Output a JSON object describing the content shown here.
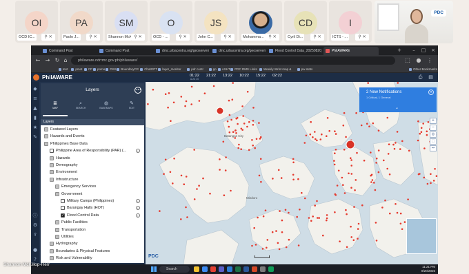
{
  "participants": [
    {
      "initials": "OI",
      "name": "OCD IC...",
      "color": "#f4d5c8"
    },
    {
      "initials": "PA",
      "name": "Paolo J...",
      "color": "#f1d9c9"
    },
    {
      "initials": "SM",
      "name": "Shannon McKi...",
      "color": "#d9dff3"
    },
    {
      "initials": "O",
      "name": "OCD - ...",
      "color": "#d9e2f2"
    },
    {
      "initials": "JS",
      "name": "John C...",
      "color": "#f4e3c1"
    },
    {
      "initials": "",
      "name": "Mohamma...",
      "color": "#eeeeee"
    },
    {
      "initials": "CD",
      "name": "Cyril Di...",
      "color": "#e7e2b7"
    },
    {
      "initials": "I",
      "name": "ICTS - ...",
      "color": "#f3d0d4"
    }
  ],
  "camera": {
    "logo": "PDC"
  },
  "presenter_caption": "Shannon McKillop-Herr",
  "browser": {
    "tabs": [
      {
        "label": "Command Post",
        "active": false
      },
      {
        "label": "Command Post",
        "active": false
      },
      {
        "label": "dmc.urbacentra.org/geoserver/geo...",
        "active": false
      },
      {
        "label": "dmc.urbacentra.org/geoserver/geo...",
        "active": false
      },
      {
        "label": "Flood Control Data_20250820_v4.pdf",
        "active": false
      },
      {
        "label": "PhilAWARE",
        "active": true
      }
    ],
    "url": "philaware.ndrrmc.gov.ph/philaware/",
    "bookmarks": [
      "test",
      "pmot",
      "CP",
      "pomo",
      "DSS",
      "BoundaryCR",
      "ChatGPT",
      "layer_monitor",
      "pdr contr",
      "pp",
      "ASHT",
      "PDC RMS Links",
      "Weekly Wrist map &",
      "pw stats",
      "Other Bookmarks"
    ]
  },
  "app": {
    "title": "PhilAWARE",
    "times": [
      {
        "time": "01:22",
        "date": "AUG 20"
      },
      {
        "time": "21:22",
        "date": ""
      },
      {
        "time": "13:22",
        "date": ""
      },
      {
        "time": "10:22",
        "date": ""
      },
      {
        "time": "15:22",
        "date": ""
      },
      {
        "time": "02:22",
        "date": ""
      }
    ],
    "panel": {
      "title": "Layers",
      "tabs": [
        {
          "label": "MAP",
          "icon": "layers-icon"
        },
        {
          "label": "SEARCH",
          "icon": "search-icon"
        },
        {
          "label": "BASEMAPS",
          "icon": "globe-icon"
        },
        {
          "label": "EDIT",
          "icon": "pencil-icon"
        }
      ],
      "section_label": "Layers"
    },
    "tree": [
      {
        "label": "Featured Layers",
        "indent": 0,
        "kind": "exp",
        "info": false
      },
      {
        "label": "Hazards and Events",
        "indent": 0,
        "kind": "exp",
        "info": false
      },
      {
        "label": "Philippines Base Data",
        "indent": 0,
        "kind": "exp",
        "info": false
      },
      {
        "label": "Philippine Area of Responsibility (PAR) (...",
        "indent": 1,
        "kind": "cb",
        "info": true
      },
      {
        "label": "Hazards",
        "indent": 1,
        "kind": "exp",
        "info": false
      },
      {
        "label": "Demography",
        "indent": 1,
        "kind": "exp",
        "info": false
      },
      {
        "label": "Environment",
        "indent": 1,
        "kind": "exp",
        "info": false
      },
      {
        "label": "Infrastructure",
        "indent": 1,
        "kind": "exp",
        "info": false
      },
      {
        "label": "Emergency Services",
        "indent": 2,
        "kind": "exp",
        "info": false
      },
      {
        "label": "Government",
        "indent": 2,
        "kind": "exp",
        "info": false
      },
      {
        "label": "Military Camps (Philippines)",
        "indent": 3,
        "kind": "cb",
        "info": true
      },
      {
        "label": "Barangay Halls (HOT)",
        "indent": 3,
        "kind": "cb",
        "info": true
      },
      {
        "label": "Flood Control Data",
        "indent": 3,
        "kind": "cb",
        "checked": true,
        "info": true
      },
      {
        "label": "Public Facilities",
        "indent": 2,
        "kind": "exp",
        "info": false
      },
      {
        "label": "Transportation",
        "indent": 2,
        "kind": "exp",
        "info": false
      },
      {
        "label": "Utilities",
        "indent": 2,
        "kind": "exp",
        "info": false
      },
      {
        "label": "Hydrography",
        "indent": 1,
        "kind": "exp",
        "info": false
      },
      {
        "label": "Boundaries & Physical Features",
        "indent": 1,
        "kind": "exp",
        "info": false
      },
      {
        "label": "Risk and Vulnerability",
        "indent": 1,
        "kind": "exp",
        "info": false
      },
      {
        "label": "Disaster Events",
        "indent": 1,
        "kind": "exp",
        "info": false
      }
    ],
    "notification": {
      "title": "2 New Notifications",
      "subtitle": "1 Critical, 1 General"
    },
    "map_labels": [
      "Batangas City",
      "Mindoro"
    ],
    "pdc_mark": "PDC",
    "colors": {
      "accent": "#2f7ee0",
      "marker": "#e53b2f",
      "water": "#cfdde6",
      "land": "#f2f1ec"
    }
  },
  "taskbar": {
    "search": "Search",
    "time": "11:21 PM",
    "date": "8/20/2025"
  }
}
